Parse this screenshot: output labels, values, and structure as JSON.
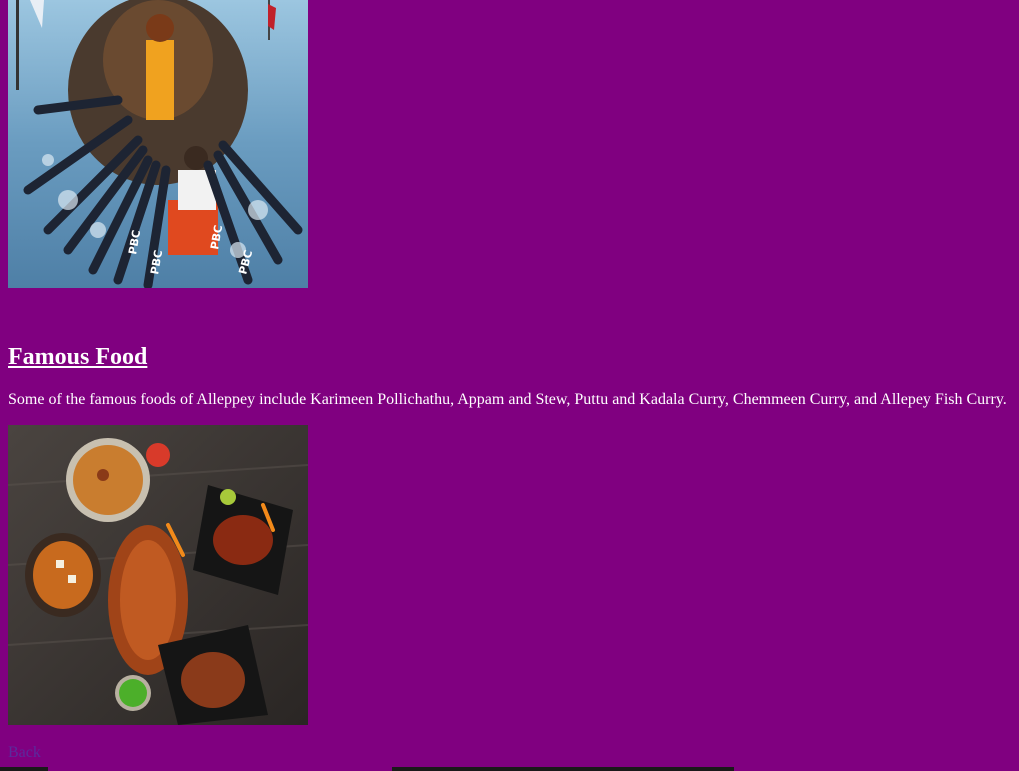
{
  "sections": {
    "food": {
      "heading": "Famous Food",
      "description": "Some of the famous foods of Alleppey include Karimeen Pollichathu, Appam and Stew, Puttu and Kadala Curry, Chemmeen Curry, and Allepey Fish Curry."
    }
  },
  "nav": {
    "back_label": "Back"
  },
  "images": {
    "boat_overlay_text": "PBC"
  },
  "colors": {
    "background": "#800080",
    "text": "#ffffff",
    "link": "#5b2a9c"
  }
}
